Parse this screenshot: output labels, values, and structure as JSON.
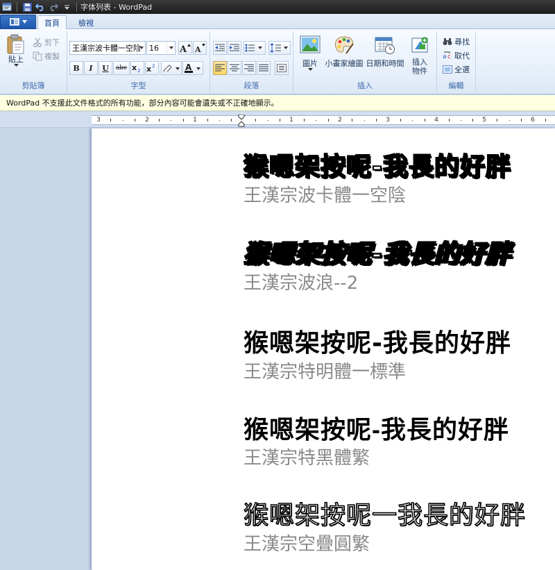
{
  "window": {
    "title": "字体列表 - WordPad"
  },
  "tabs": [
    {
      "label": "首頁"
    },
    {
      "label": "檢視"
    }
  ],
  "clipboard": {
    "paste": "貼上",
    "cut": "剪下",
    "copy": "複製",
    "group": "剪貼簿"
  },
  "font": {
    "name": "王漢宗波卡體一空陰",
    "size": "16",
    "group": "字型"
  },
  "paragraph": {
    "group": "段落"
  },
  "insert": {
    "picture": "圖片",
    "paint": "小畫家繪圖",
    "datetime": "日期和時間",
    "object_line1": "插入",
    "object_line2": "物件",
    "group": "插入"
  },
  "editing": {
    "find": "尋找",
    "replace": "取代",
    "select_all": "全選",
    "group": "編輯"
  },
  "infobar": {
    "message": "WordPad 不支援此文件格式的所有功能，部分內容可能會遺失或不正確地顯示。"
  },
  "ruler": {
    "labels": [
      "3",
      "2",
      "1",
      "1",
      "2",
      "3",
      "4",
      "5",
      "6"
    ]
  },
  "document": {
    "samples": [
      {
        "text": "猴嗯架按呢-我長的好胖",
        "font_name": "王漢宗波卡體一空陰"
      },
      {
        "text": "猴嗯架按呢-我長的好胖",
        "font_name": "王漢宗波浪--2"
      },
      {
        "text": "猴嗯架按呢-我長的好胖",
        "font_name": "王漢宗特明體一標準"
      },
      {
        "text": "猴嗯架按呢-我長的好胖",
        "font_name": "王漢宗特黑體繁"
      },
      {
        "text": "猴嗯架按呢一我長的好胖",
        "font_name": "王漢宗空疊圓繁"
      }
    ]
  }
}
